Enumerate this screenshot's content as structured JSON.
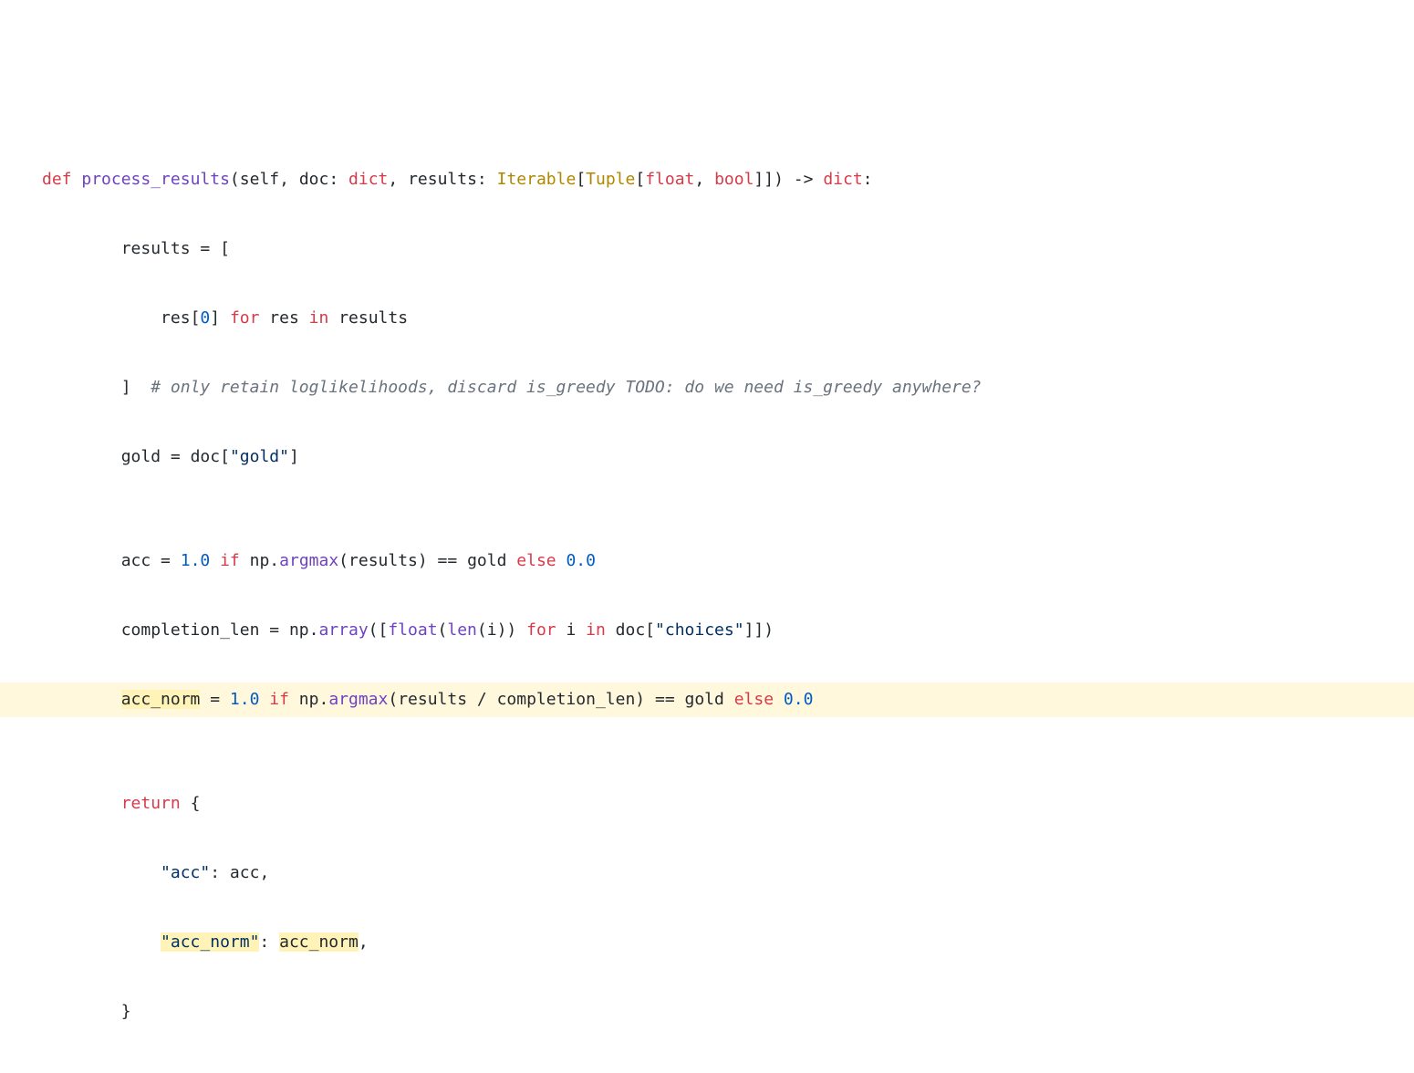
{
  "code": {
    "line1": {
      "def": "def",
      "fname": "process_results",
      "lparen": "(",
      "p_self": "self",
      "c1": ", ",
      "p_doc": "doc",
      "colon1": ": ",
      "t_dict": "dict",
      "c2": ", ",
      "p_results": "results",
      "colon2": ": ",
      "t_iterable": "Iterable",
      "lb": "[",
      "t_tuple": "Tuple",
      "lb2": "[",
      "t_float": "float",
      "c3": ", ",
      "t_bool": "bool",
      "rb2": "]",
      "rb": "]",
      "rparen": ")",
      "arrow": " -> ",
      "t_ret": "dict",
      "end": ":"
    },
    "line2": {
      "indent": "        ",
      "lhs": "results",
      "eq": " = ",
      "bracket": "["
    },
    "line3": {
      "indent": "            ",
      "res": "res",
      "lb": "[",
      "idx": "0",
      "rb": "]",
      "sp": " ",
      "for": "for",
      "sp2": " ",
      "var": "res",
      "sp3": " ",
      "in": "in",
      "sp4": " ",
      "iter": "results"
    },
    "line4": {
      "indent": "        ",
      "rb": "]",
      "sp": "  ",
      "comment": "# only retain loglikelihoods, discard is_greedy TODO: do we need is_greedy anywhere?"
    },
    "line5": {
      "indent": "        ",
      "lhs": "gold",
      "eq": " = ",
      "doc": "doc",
      "lb": "[",
      "key": "\"gold\"",
      "rb": "]"
    },
    "line6": {
      "blank": ""
    },
    "line7": {
      "indent": "        ",
      "lhs": "acc",
      "eq": " = ",
      "v1": "1.0",
      "if": " if ",
      "np": "np",
      "dot": ".",
      "argmax": "argmax",
      "lp": "(",
      "arg": "results",
      "rp": ")",
      "eqeq": " == ",
      "gold": "gold",
      "else": " else ",
      "v0": "0.0"
    },
    "line8": {
      "indent": "        ",
      "lhs": "completion_len",
      "eq": " = ",
      "np": "np",
      "dot": ".",
      "array": "array",
      "lp": "(",
      "lb": "[",
      "float": "float",
      "lp2": "(",
      "len": "len",
      "lp3": "(",
      "i": "i",
      "rp3": ")",
      "rp2": ")",
      "for": " for ",
      "i2": "i",
      "in": " in ",
      "doc": "doc",
      "lb2": "[",
      "key": "\"choices\"",
      "rb2": "]",
      "rb": "]",
      "rp": ")"
    },
    "line9": {
      "indent": "        ",
      "lhs": "acc_norm",
      "eq": " = ",
      "v1": "1.0",
      "if": " if ",
      "np": "np",
      "dot": ".",
      "argmax": "argmax",
      "lp": "(",
      "arg1": "results",
      "div": " / ",
      "arg2": "completion_len",
      "rp": ")",
      "eqeq": " == ",
      "gold": "gold",
      "else": " else ",
      "v0": "0.0"
    },
    "line10": {
      "blank": ""
    },
    "line11": {
      "indent": "        ",
      "return": "return",
      "sp": " ",
      "brace": "{"
    },
    "line12": {
      "indent": "            ",
      "key": "\"acc\"",
      "colon": ": ",
      "val": "acc",
      "comma": ","
    },
    "line13": {
      "indent": "            ",
      "key": "\"acc_norm\"",
      "colon": ": ",
      "val": "acc_norm",
      "comma": ","
    },
    "line14": {
      "indent": "        ",
      "brace": "}"
    }
  }
}
